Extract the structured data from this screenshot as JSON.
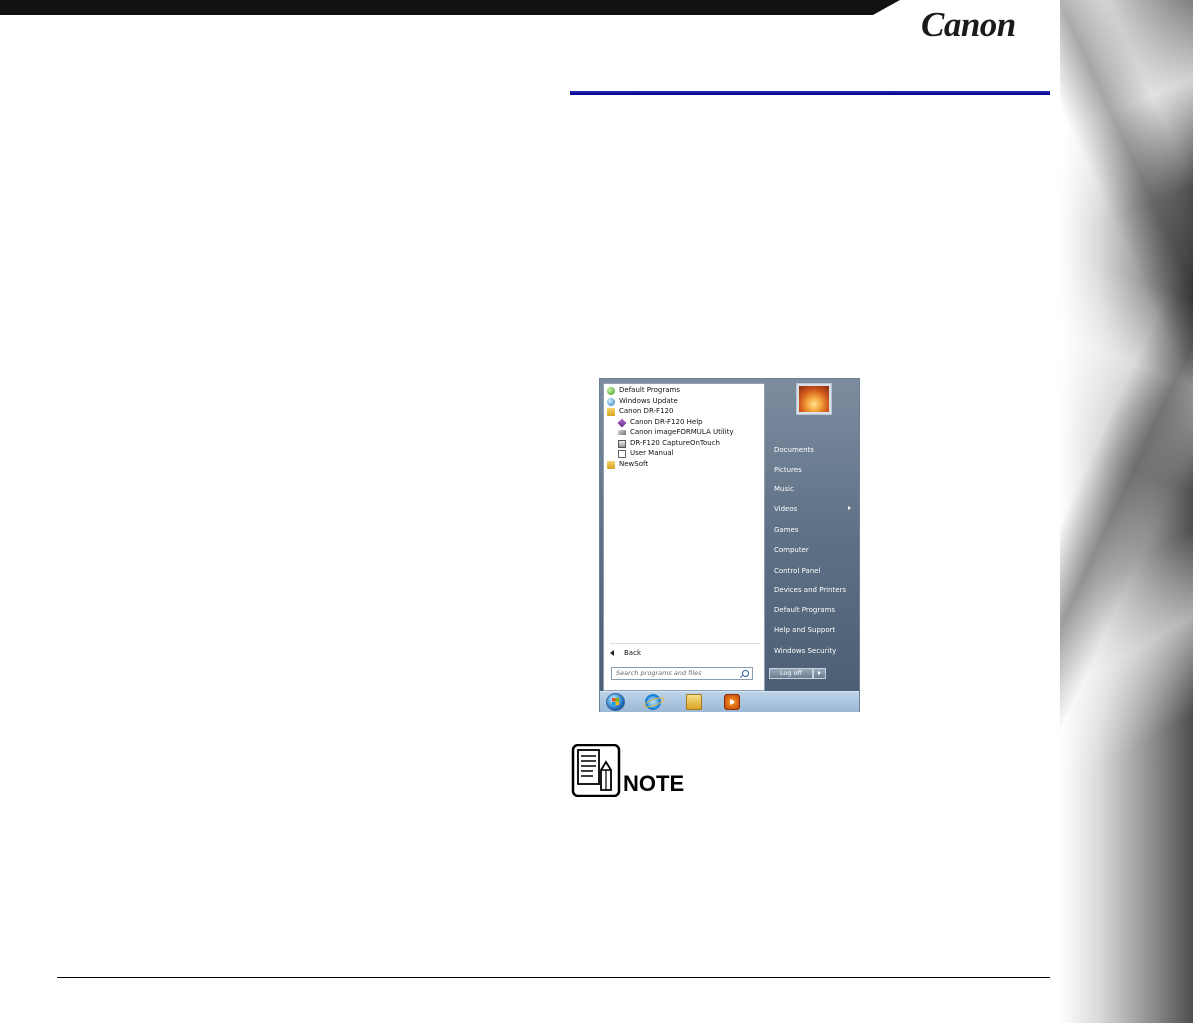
{
  "header": {
    "brand": "Canon"
  },
  "start_menu": {
    "programs": [
      {
        "label": "Default Programs",
        "icon": "default-programs-icon"
      },
      {
        "label": "Windows Update",
        "icon": "windows-update-icon"
      },
      {
        "label": "Canon DR-F120",
        "icon": "folder-icon"
      },
      {
        "label": "Canon DR-F120 Help",
        "icon": "help-icon"
      },
      {
        "label": "Canon imageFORMULA Utility",
        "icon": "utility-icon"
      },
      {
        "label": "DR-F120 CaptureOnTouch",
        "icon": "scanner-icon"
      },
      {
        "label": "User Manual",
        "icon": "document-icon"
      },
      {
        "label": "NewSoft",
        "icon": "folder-icon"
      }
    ],
    "back_label": "Back",
    "search_placeholder": "Search programs and files",
    "right_items": [
      "Documents",
      "Pictures",
      "Music",
      "Videos",
      "Games",
      "Computer",
      "Control Panel",
      "Devices and Printers",
      "Default Programs",
      "Help and Support",
      "Windows Security"
    ],
    "logoff_label": "Log off",
    "taskbar_icons": [
      "start-orb-icon",
      "internet-explorer-icon",
      "libraries-folder-icon",
      "media-player-icon"
    ]
  },
  "note": {
    "label": "NOTE"
  }
}
